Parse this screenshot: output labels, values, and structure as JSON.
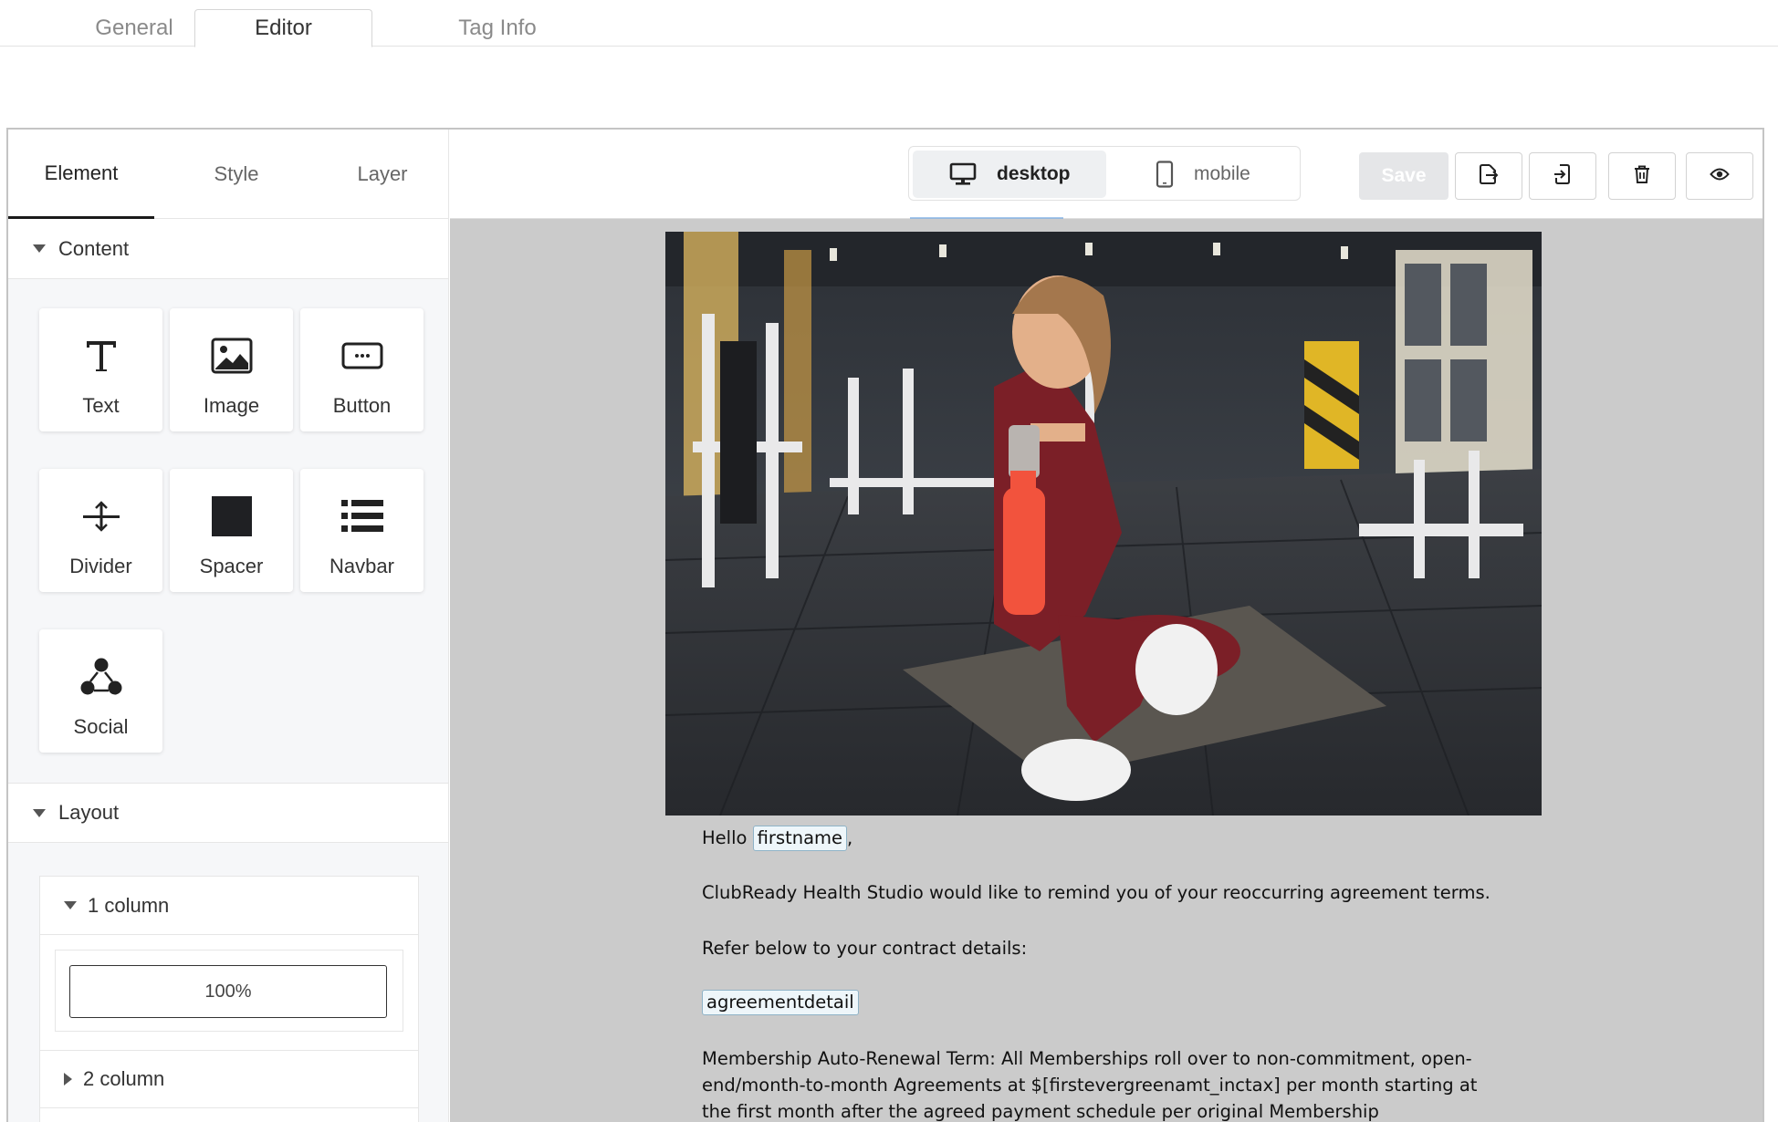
{
  "top_tabs": [
    {
      "label": "General"
    },
    {
      "label": "Editor",
      "active": true
    },
    {
      "label": "Tag Info"
    }
  ],
  "left_panel": {
    "tabs": [
      {
        "label": "Element",
        "active": true
      },
      {
        "label": "Style"
      },
      {
        "label": "Layer"
      }
    ],
    "content_section": {
      "title": "Content",
      "elements": [
        {
          "label": "Text",
          "icon": "text-icon"
        },
        {
          "label": "Image",
          "icon": "image-icon"
        },
        {
          "label": "Button",
          "icon": "button-icon"
        },
        {
          "label": "Divider",
          "icon": "divider-icon"
        },
        {
          "label": "Spacer",
          "icon": "spacer-icon"
        },
        {
          "label": "Navbar",
          "icon": "navbar-icon"
        },
        {
          "label": "Social",
          "icon": "social-icon"
        }
      ]
    },
    "layout_section": {
      "title": "Layout",
      "one_column": {
        "label": "1 column",
        "preview": "100%"
      },
      "two_column": {
        "label": "2 column"
      }
    }
  },
  "toolbar": {
    "device_desktop": "desktop",
    "device_mobile": "mobile",
    "save_label": "Save",
    "icons": [
      "export-icon",
      "import-icon",
      "trash-icon",
      "eye-icon"
    ]
  },
  "email": {
    "greeting": "Hello",
    "firstname_tag": "firstname",
    "greeting_comma": ",",
    "line1": "ClubReady Health Studio would like to remind you of your reoccurring agreement terms.",
    "line2": "Refer below to your contract details:",
    "agreement_tag": "agreementdetail",
    "para_line1": "Membership Auto-Renewal Term: All Memberships roll over to non-commitment, open-",
    "para_line2": "end/month-to-month Agreements at $[firstevergreenamt_inctax] per month starting at",
    "para_line3": "the first month after the agreed payment schedule per original Membership"
  },
  "colors": {
    "accent": "#1a1a1a",
    "canvas_bg": "#cbcbcb",
    "save_disabled": "#e5e6e8"
  }
}
